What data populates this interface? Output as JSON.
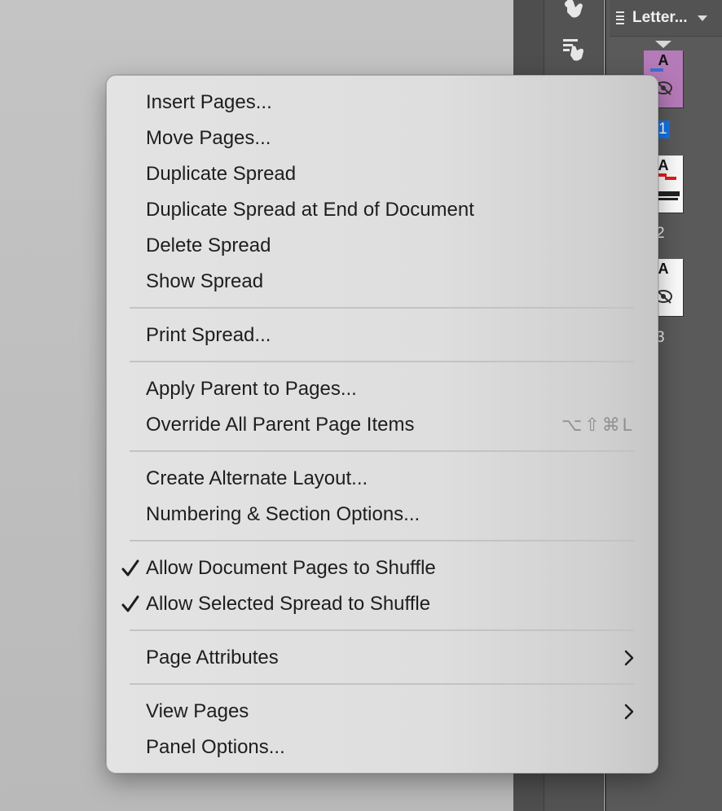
{
  "panel": {
    "page_size_label": "Letter...",
    "pages": [
      {
        "number": "1",
        "glyph": "A",
        "selected": true
      },
      {
        "number": "2",
        "glyph": "A",
        "selected": false
      },
      {
        "number": "3",
        "glyph": "A",
        "selected": false
      }
    ]
  },
  "menu": {
    "groups": [
      [
        {
          "label": "Insert Pages..."
        },
        {
          "label": "Move Pages..."
        },
        {
          "label": "Duplicate Spread"
        },
        {
          "label": "Duplicate Spread at End of Document"
        },
        {
          "label": "Delete Spread"
        },
        {
          "label": "Show Spread"
        }
      ],
      [
        {
          "label": "Print Spread..."
        }
      ],
      [
        {
          "label": "Apply Parent to Pages..."
        },
        {
          "label": "Override All Parent Page Items",
          "shortcut": "⌥⇧⌘L"
        }
      ],
      [
        {
          "label": "Create Alternate Layout..."
        },
        {
          "label": "Numbering & Section Options..."
        }
      ],
      [
        {
          "label": "Allow Document Pages to Shuffle",
          "checked": true
        },
        {
          "label": "Allow Selected Spread to Shuffle",
          "checked": true
        }
      ],
      [
        {
          "label": "Page Attributes",
          "submenu": true
        }
      ],
      [
        {
          "label": "View Pages",
          "submenu": true
        },
        {
          "label": "Panel Options..."
        }
      ]
    ]
  },
  "icons": {
    "toolbar_top": "hand-pointer-icon",
    "toolbar_second": "hand-list-icon",
    "panel_menu": "panel-menu-icon",
    "check": "checkmark-icon",
    "submenu": "chevron-right-icon"
  }
}
